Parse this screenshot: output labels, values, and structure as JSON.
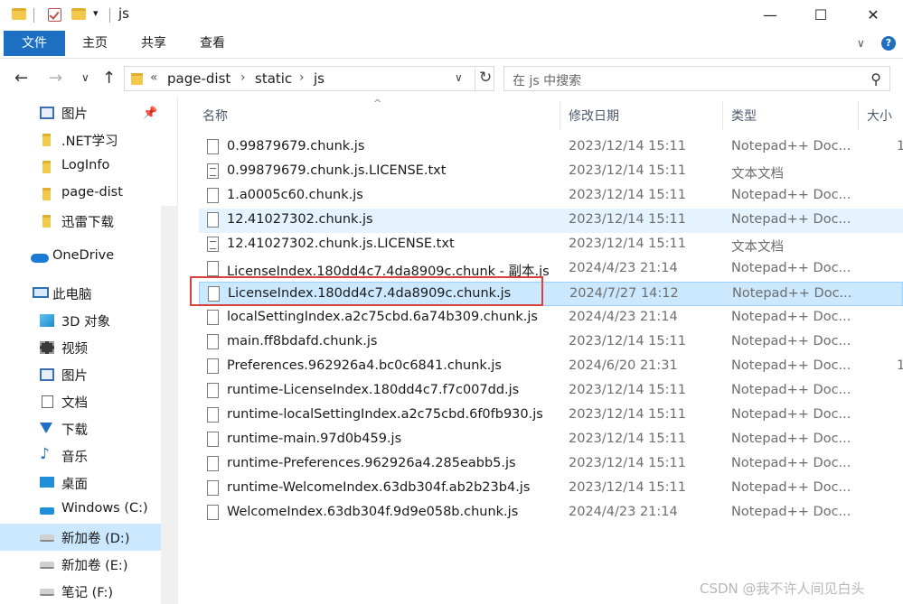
{
  "window": {
    "title": "js",
    "controls": {
      "minimize": "—",
      "maximize": "☐",
      "close": "✕"
    }
  },
  "ribbon": {
    "tabs": [
      "文件",
      "主页",
      "共享",
      "查看"
    ],
    "collapse": "∨",
    "help": "?"
  },
  "nav": {
    "back": "←",
    "forward": "→",
    "recent": "∨",
    "up": "↑",
    "path_prefix": "«",
    "path": [
      "page-dist",
      "static",
      "js"
    ],
    "path_sep": "›",
    "dropdown": "∨",
    "refresh": "↻"
  },
  "search": {
    "placeholder": "在 js 中搜索",
    "icon": "search-icon"
  },
  "sidebar": {
    "pin": "📌",
    "items": [
      {
        "label": "图片",
        "icon": "pictures-icon"
      },
      {
        "label": ".NET学习",
        "icon": "folder-icon"
      },
      {
        "label": "LogInfo",
        "icon": "folder-icon"
      },
      {
        "label": "page-dist",
        "icon": "folder-icon"
      },
      {
        "label": "迅雷下载",
        "icon": "folder-icon"
      },
      {
        "label": "OneDrive",
        "icon": "cloud-icon"
      },
      {
        "label": "此电脑",
        "icon": "computer-icon"
      },
      {
        "label": "3D 对象",
        "icon": "3d-objects-icon"
      },
      {
        "label": "视频",
        "icon": "video-icon"
      },
      {
        "label": "图片",
        "icon": "pictures-icon"
      },
      {
        "label": "文档",
        "icon": "documents-icon"
      },
      {
        "label": "下载",
        "icon": "download-icon"
      },
      {
        "label": "音乐",
        "icon": "music-icon"
      },
      {
        "label": "桌面",
        "icon": "desktop-icon"
      },
      {
        "label": "Windows (C:)",
        "icon": "windows-drive-icon"
      },
      {
        "label": "新加卷 (D:)",
        "icon": "drive-icon"
      },
      {
        "label": "新加卷 (E:)",
        "icon": "drive-icon"
      },
      {
        "label": "笔记 (F:)",
        "icon": "drive-icon"
      }
    ]
  },
  "columns": {
    "name": "名称",
    "date": "修改日期",
    "type": "类型",
    "size": "大小",
    "sort_indicator": "^"
  },
  "files": [
    {
      "name": "0.99879679.chunk.js",
      "date": "2023/12/14 15:11",
      "type": "Notepad++ Doc...",
      "size": "1",
      "kind": "js"
    },
    {
      "name": "0.99879679.chunk.js.LICENSE.txt",
      "date": "2023/12/14 15:11",
      "type": "文本文档",
      "size": "",
      "kind": "txt"
    },
    {
      "name": "1.a0005c60.chunk.js",
      "date": "2023/12/14 15:11",
      "type": "Notepad++ Doc...",
      "size": "",
      "kind": "js"
    },
    {
      "name": "12.41027302.chunk.js",
      "date": "2023/12/14 15:11",
      "type": "Notepad++ Doc...",
      "size": "",
      "kind": "js"
    },
    {
      "name": "12.41027302.chunk.js.LICENSE.txt",
      "date": "2023/12/14 15:11",
      "type": "文本文档",
      "size": "",
      "kind": "txt"
    },
    {
      "name": "LicenseIndex.180dd4c7.4da8909c.chunk - 副本.js",
      "date": "2024/4/23 21:14",
      "type": "Notepad++ Doc...",
      "size": "",
      "kind": "js"
    },
    {
      "name": "LicenseIndex.180dd4c7.4da8909c.chunk.js",
      "date": "2024/7/27 14:12",
      "type": "Notepad++ Doc...",
      "size": "",
      "kind": "js"
    },
    {
      "name": "localSettingIndex.a2c75cbd.6a74b309.chunk.js",
      "date": "2024/4/23 21:14",
      "type": "Notepad++ Doc...",
      "size": "",
      "kind": "js"
    },
    {
      "name": "main.ff8bdafd.chunk.js",
      "date": "2023/12/14 15:11",
      "type": "Notepad++ Doc...",
      "size": "",
      "kind": "js"
    },
    {
      "name": "Preferences.962926a4.bc0c6841.chunk.js",
      "date": "2024/6/20 21:31",
      "type": "Notepad++ Doc...",
      "size": "1",
      "kind": "js"
    },
    {
      "name": "runtime-LicenseIndex.180dd4c7.f7c007dd.js",
      "date": "2023/12/14 15:11",
      "type": "Notepad++ Doc...",
      "size": "",
      "kind": "js"
    },
    {
      "name": "runtime-localSettingIndex.a2c75cbd.6f0fb930.js",
      "date": "2023/12/14 15:11",
      "type": "Notepad++ Doc...",
      "size": "",
      "kind": "js"
    },
    {
      "name": "runtime-main.97d0b459.js",
      "date": "2023/12/14 15:11",
      "type": "Notepad++ Doc...",
      "size": "",
      "kind": "js"
    },
    {
      "name": "runtime-Preferences.962926a4.285eabb5.js",
      "date": "2023/12/14 15:11",
      "type": "Notepad++ Doc...",
      "size": "",
      "kind": "js"
    },
    {
      "name": "runtime-WelcomeIndex.63db304f.ab2b23b4.js",
      "date": "2023/12/14 15:11",
      "type": "Notepad++ Doc...",
      "size": "",
      "kind": "js"
    },
    {
      "name": "WelcomeIndex.63db304f.9d9e058b.chunk.js",
      "date": "2024/4/23 21:14",
      "type": "Notepad++ Doc...",
      "size": "",
      "kind": "js"
    }
  ],
  "watermark": "CSDN @我不许人间见白头"
}
